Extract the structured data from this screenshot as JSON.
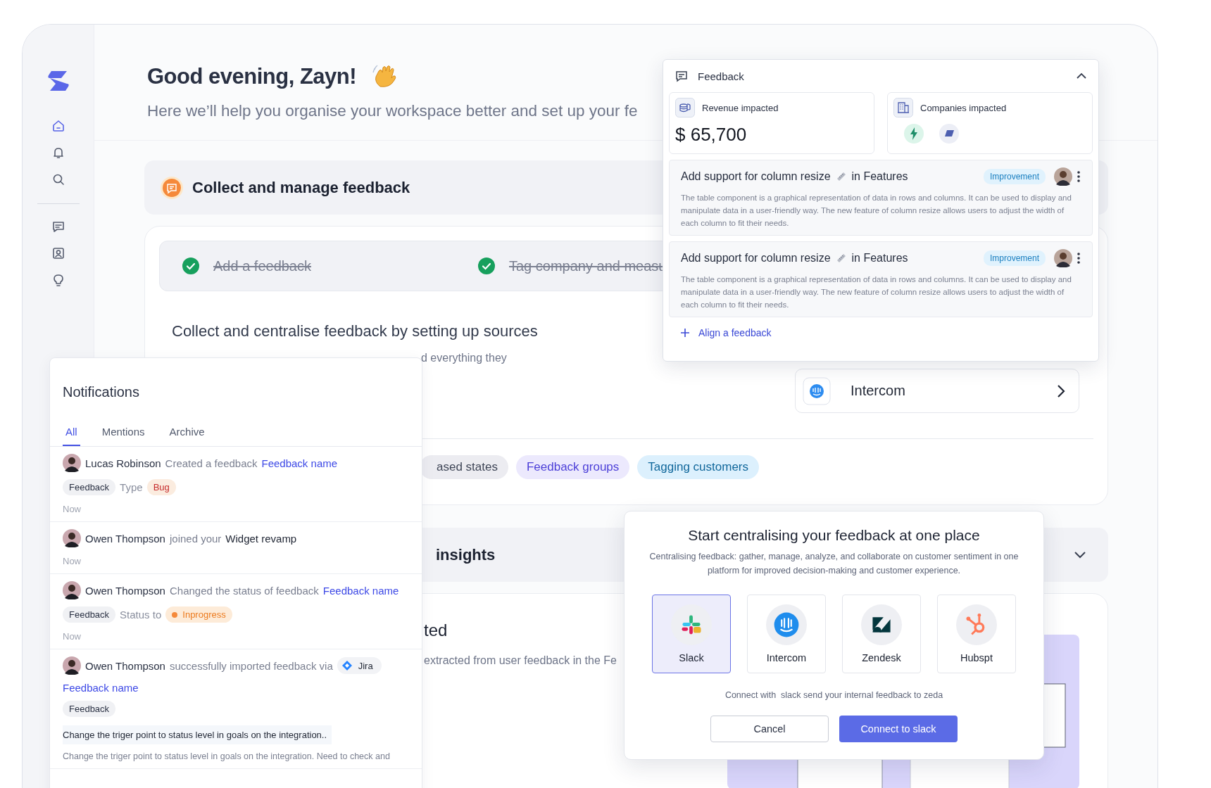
{
  "sidebar": {
    "items": [
      {
        "selected": true
      },
      {
        "selected": false
      },
      {
        "selected": false
      },
      {
        "selected": false
      },
      {
        "selected": false
      },
      {
        "selected": false
      }
    ]
  },
  "greeting": {
    "title": "Good evening, Zayn!",
    "subtitle": "Here we’ll help you organise your workspace better and set up your fe"
  },
  "collect_section": {
    "title": "Collect and manage feedback",
    "steps": [
      {
        "label": "Add a feedback",
        "done": true
      },
      {
        "label": "Tag company and measu",
        "done": true
      }
    ],
    "heading": "Collect and centralise feedback by setting up sources",
    "description": "d everything they",
    "source": {
      "name": "Intercom"
    },
    "chips": [
      {
        "label": "ased states",
        "kind": "neutral"
      },
      {
        "label": "Feedback groups",
        "kind": "accent"
      },
      {
        "label": "Tagging customers",
        "kind": "info"
      }
    ]
  },
  "insights_section": {
    "title": "insights",
    "expanded": false
  },
  "extracted_section": {
    "title": "ted",
    "description": "extracted from user feedback in the Fe"
  },
  "notifications": {
    "title": "Notifications",
    "tabs": [
      {
        "label": "All",
        "selected": true
      },
      {
        "label": "Mentions",
        "selected": false
      },
      {
        "label": "Archive",
        "selected": false
      }
    ],
    "items": [
      {
        "user": "Lucas Robinson",
        "action": "Created a feedback",
        "link": "Feedback name",
        "link_on_new_line": false,
        "tags": [
          {
            "label": "Feedback",
            "kind": "plain"
          },
          {
            "label": "Type",
            "kind": "text"
          },
          {
            "label": "Bug",
            "kind": "bug"
          }
        ],
        "time": "Now"
      },
      {
        "user": "Owen Thompson",
        "action": "joined your",
        "project": "Widget revamp",
        "time": "Now"
      },
      {
        "user": "Owen Thompson",
        "action": "Changed the status of feedback",
        "link": "Feedback name",
        "link_on_new_line": false,
        "tags": [
          {
            "label": "Feedback",
            "kind": "plain"
          },
          {
            "label": "Status to",
            "kind": "text"
          },
          {
            "label": "Inprogress",
            "kind": "status"
          }
        ],
        "time": "Now"
      },
      {
        "user": "Owen Thompson",
        "action": "successfully imported feedback via",
        "source": "Jira",
        "link": "Feedback name",
        "link_on_new_line": true,
        "tags": [
          {
            "label": "Feedback",
            "kind": "plain"
          }
        ],
        "summary": "Change the triger point to status level in goals on the integration..",
        "body": "Change the triger point to status level in goals on the integration. Need to check and"
      }
    ]
  },
  "feedback_panel": {
    "title": "Feedback",
    "expanded": true,
    "revenue": {
      "label": "Revenue impacted",
      "value": "$ 65,700"
    },
    "companies": {
      "label": "Companies impacted"
    },
    "items": [
      {
        "title": "Add support for column resize",
        "suffix": "in Features",
        "tag": "Improvement",
        "description": "The table component is a graphical representation of data in rows and columns. It can be used to display and manipulate data in a user-friendly way. The new feature of column resize allows users to adjust the width of each column to fit their needs."
      },
      {
        "title": "Add support for column resize",
        "suffix": "in Features",
        "tag": "Improvement",
        "description": "The table component is a graphical representation of data in rows and columns. It can be used to display and manipulate data in a user-friendly way. The new feature of column resize allows users to adjust the width of each column to fit their needs."
      }
    ],
    "add_action": "Align a feedback"
  },
  "modal": {
    "title": "Start centralising your feedback at one place",
    "description": "Centralising feedback: gather, manage, analyze, and collaborate on customer sentiment in one platform for improved decision-making and customer experience.",
    "integrations": [
      {
        "name": "Slack",
        "selected": true
      },
      {
        "name": "Intercom",
        "selected": false
      },
      {
        "name": "Zendesk",
        "selected": false
      },
      {
        "name": "Hubspt",
        "selected": false
      }
    ],
    "hint": "Connect with  slack send your internal feedback to zeda",
    "buttons": [
      {
        "label": "Cancel",
        "kind": "secondary"
      },
      {
        "label": "Connect to slack",
        "kind": "primary"
      }
    ]
  }
}
